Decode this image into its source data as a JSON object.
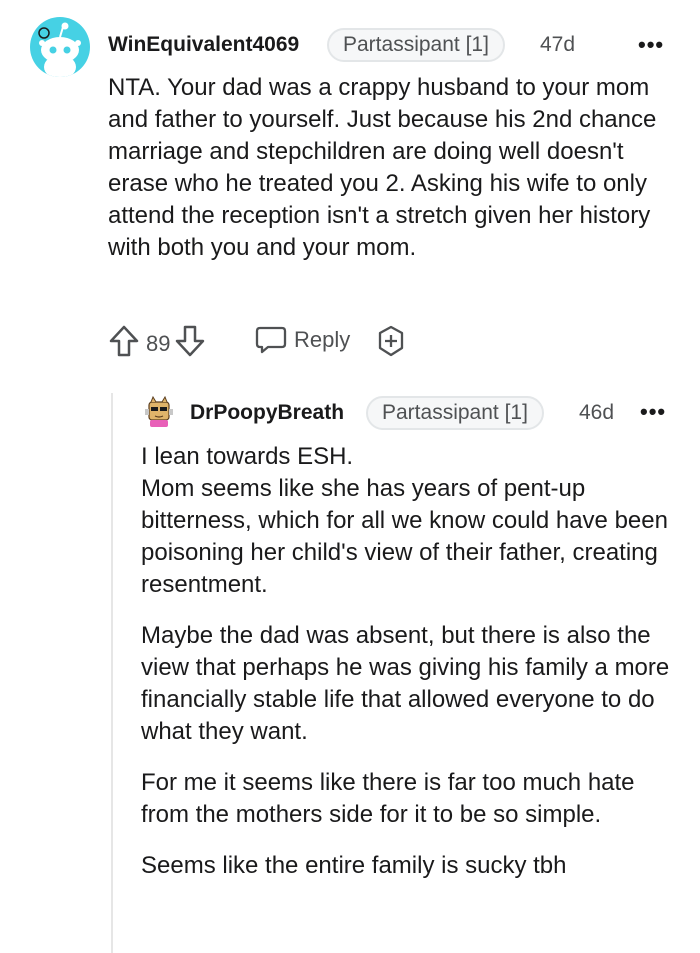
{
  "comment1": {
    "username": "WinEquivalent4069",
    "flair": "Partassipant [1]",
    "time": "47d",
    "more": "•••",
    "text": "NTA. Your dad was a crappy husband to your mom and father to yourself. Just because his 2nd chance marriage and stepchildren are doing well doesn't erase who he treated you 2. Asking his wife to only attend the reception isn't a stretch given her history with both you and your mom.",
    "votes": "89",
    "reply_label": "Reply"
  },
  "comment2": {
    "username": "DrPoopyBreath",
    "flair": "Partassipant [1]",
    "time": "46d",
    "more": "•••",
    "paragraphs": [
      "I lean towards ESH.\nMom seems like she has years of pent-up bitterness, which for all we know could have been poisoning her child's view of their father, creating resentment.",
      "Maybe the dad was absent, but there is also the view that perhaps he was giving his family a more financially stable life that allowed everyone to do what they want.",
      "For me it seems like there is far too much hate from the mothers side for it to be so simple.",
      "Seems like the entire family is sucky tbh"
    ]
  },
  "colors": {
    "avatar_bg": "#46d1e4",
    "text": "#1a1a1b",
    "meta": "#4f5153"
  },
  "icons": [
    "snoo-avatar-icon",
    "upvote-icon",
    "downvote-icon",
    "reply-icon",
    "award-icon",
    "custom-avatar-icon"
  ]
}
